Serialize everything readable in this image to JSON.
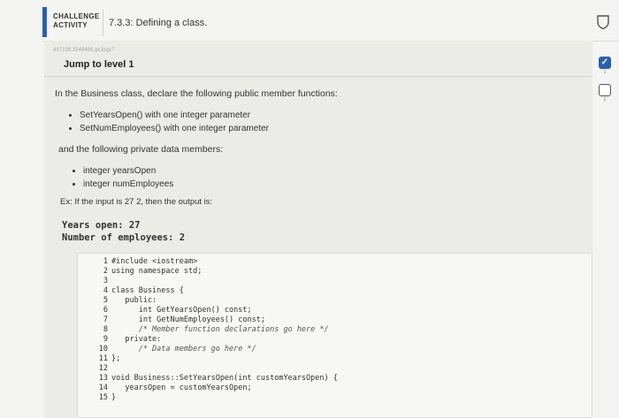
{
  "header": {
    "label_line1": "CHALLENGE",
    "label_line2": "ACTIVITY",
    "title": "7.3.3: Defining a class."
  },
  "levels": [
    {
      "number": "1",
      "status": "completed"
    },
    {
      "number": "2",
      "status": "pending"
    }
  ],
  "panel": {
    "ref_id": "497108.3248486.qx3zqy7",
    "jump_label": "Jump to level 1",
    "intro": "In the Business class, declare the following public member functions:",
    "public_functions": [
      "SetYearsOpen() with one integer parameter",
      "SetNumEmployees() with one integer parameter"
    ],
    "members_intro": "and the following private data members:",
    "private_members": [
      "integer yearsOpen",
      "integer numEmployees"
    ],
    "example": "Ex: If the input is 27  2, then the output is:",
    "output_lines": [
      "Years open: 27",
      "Number of employees: 2"
    ]
  },
  "code_lines": [
    {
      "n": "1",
      "text": "#include <iostream>"
    },
    {
      "n": "2",
      "text": "using namespace std;"
    },
    {
      "n": "3",
      "text": ""
    },
    {
      "n": "4",
      "text": "class Business {"
    },
    {
      "n": "5",
      "text": "   public:"
    },
    {
      "n": "6",
      "text": "      int GetYearsOpen() const;"
    },
    {
      "n": "7",
      "text": "      int GetNumEmployees() const;"
    },
    {
      "n": "8",
      "text": "      /* Member function declarations go here */"
    },
    {
      "n": "9",
      "text": "   private:"
    },
    {
      "n": "10",
      "text": "      /* Data members go here */"
    },
    {
      "n": "11",
      "text": "};"
    },
    {
      "n": "12",
      "text": ""
    },
    {
      "n": "13",
      "text": "void Business::SetYearsOpen(int customYearsOpen) {"
    },
    {
      "n": "14",
      "text": "   yearsOpen = customYearsOpen;"
    },
    {
      "n": "15",
      "text": "}"
    }
  ],
  "colors": {
    "accent": "#2a5fb0"
  },
  "icons": {
    "header_right": "shield-icon",
    "level_done": "check-icon"
  }
}
